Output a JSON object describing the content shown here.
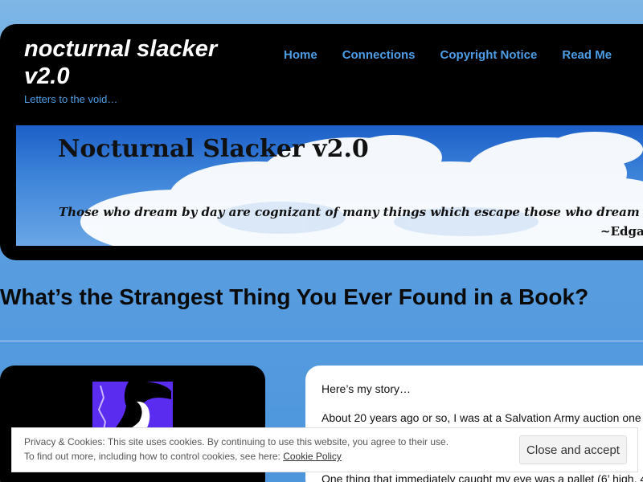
{
  "site": {
    "title": "nocturnal slacker v2.0",
    "tagline": "Letters to the void…"
  },
  "nav": {
    "items": [
      "Home",
      "Connections",
      "Copyright Notice",
      "Read Me"
    ]
  },
  "banner": {
    "title": "Nocturnal Slacker v2.0",
    "quote": "Those who dream by day are cognizant of many things which escape those who dream only by night.",
    "attribution": "~Edgar Allan Poe"
  },
  "post": {
    "title": "What’s the Strangest Thing You Ever Found in a Book?",
    "paragraphs": [
      "Here’s my story…",
      "About 20 years ago or so, I was at a Salvation Army auction one",
      "One thing that immediately caught my eye was a pallet (6’ high, 4"
    ]
  },
  "cookie": {
    "line1": "Privacy & Cookies: This site uses cookies. By continuing to use this website, you agree to their use.",
    "line2_prefix": "To find out more, including how to control cookies, see here: ",
    "link": "Cookie Policy",
    "accept": "Close and accept"
  },
  "colors": {
    "accent": "#4d9ee6",
    "header_bg": "#000000",
    "avatar_bg": "#5a2cf0"
  }
}
